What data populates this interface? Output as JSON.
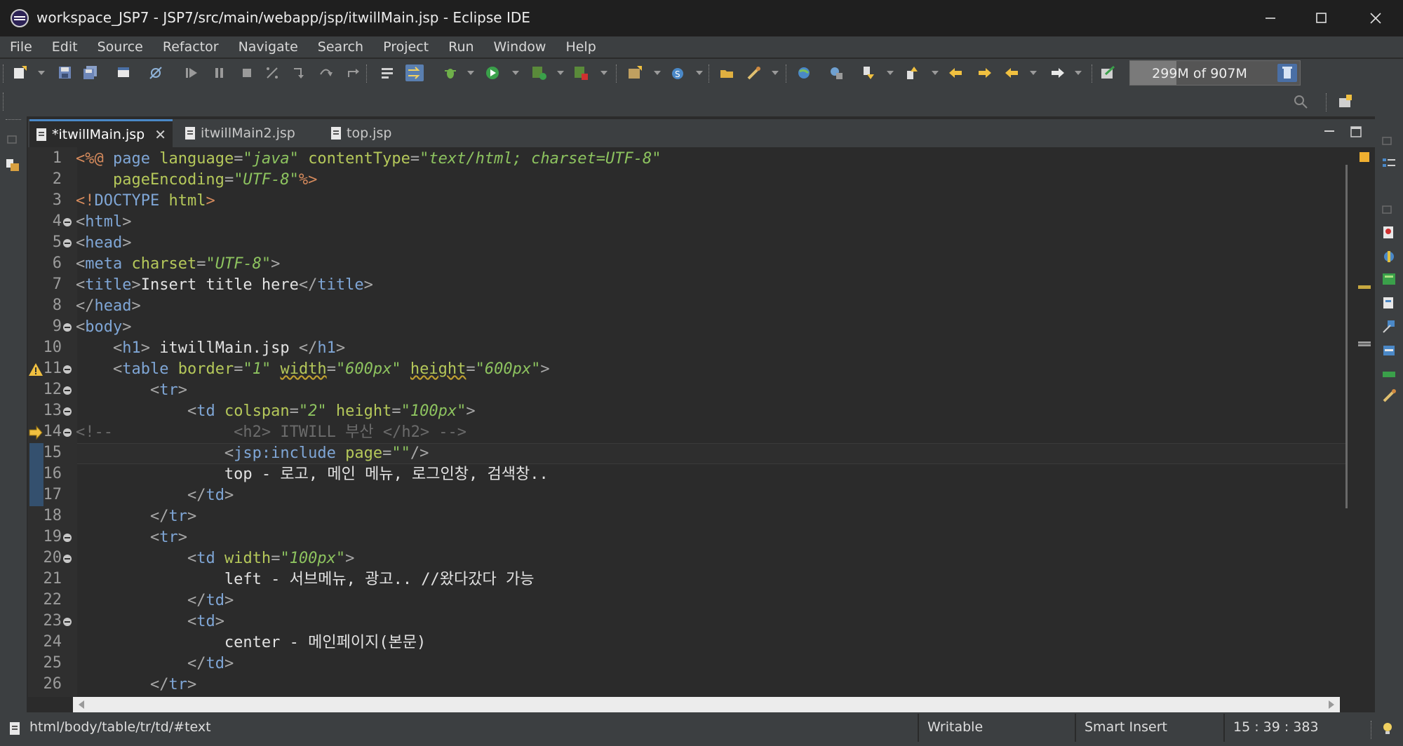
{
  "window": {
    "title": "workspace_JSP7 - JSP7/src/main/webapp/jsp/itwillMain.jsp - Eclipse IDE",
    "controls": [
      "minimize-icon",
      "maximize-icon",
      "close-icon"
    ]
  },
  "menubar": {
    "items": [
      "File",
      "Edit",
      "Source",
      "Refactor",
      "Navigate",
      "Search",
      "Project",
      "Run",
      "Window",
      "Help"
    ]
  },
  "toolbar": {
    "heap_status": "299M of 907M",
    "heap_used_fraction": 0.33,
    "icons": [
      "new-icon",
      "save-icon",
      "save-all-icon",
      "console-icon",
      "skip-breakpoints-icon",
      "resume-icon",
      "suspend-icon",
      "terminate-icon",
      "disconnect-icon",
      "step-into-icon",
      "step-over-icon",
      "step-return-icon",
      "drop-to-frame-icon",
      "use-step-filters-icon",
      "debug-icon",
      "run-icon",
      "run-server-icon",
      "stop-server-icon",
      "new-package-icon",
      "new-class-icon",
      "open-type-icon",
      "search-icon",
      "web-browser-icon",
      "external-tools-icon",
      "next-annotation-icon",
      "previous-annotation-icon",
      "back-icon",
      "forward-icon",
      "last-edit-icon",
      "pin-editor-icon",
      "garbage-collect-icon",
      "quick-access-search-icon",
      "open-perspective-icon",
      "java-ee-perspective-icon"
    ]
  },
  "tabs": [
    {
      "label": "*itwillMain.jsp",
      "active": true,
      "closable": true
    },
    {
      "label": "itwillMain2.jsp",
      "active": false,
      "closable": false
    },
    {
      "label": "top.jsp",
      "active": false,
      "closable": false
    }
  ],
  "editor": {
    "line_numbers": [
      "1",
      "2",
      "3",
      "4",
      "5",
      "6",
      "7",
      "8",
      "9",
      "10",
      "11",
      "12",
      "13",
      "14",
      "15",
      "16",
      "17",
      "18",
      "19",
      "20",
      "21",
      "22",
      "23",
      "24",
      "25",
      "26"
    ],
    "current_line": "15",
    "lines": [
      [
        [
          "d",
          "<%@"
        ],
        [
          "w",
          " "
        ],
        [
          "t",
          "page"
        ],
        [
          "w",
          " "
        ],
        [
          "a",
          "language"
        ],
        [
          "p",
          "="
        ],
        [
          "v",
          "\"java\""
        ],
        [
          "w",
          " "
        ],
        [
          "a",
          "contentType"
        ],
        [
          "p",
          "="
        ],
        [
          "v",
          "\"text/html; charset=UTF-8\""
        ]
      ],
      [
        [
          "w",
          "    "
        ],
        [
          "a",
          "pageEncoding"
        ],
        [
          "p",
          "="
        ],
        [
          "v",
          "\"UTF-8\""
        ],
        [
          "d",
          "%>"
        ]
      ],
      [
        [
          "d",
          "<!"
        ],
        [
          "t",
          "DOCTYPE"
        ],
        [
          "w",
          " "
        ],
        [
          "a",
          "html"
        ],
        [
          "d",
          ">"
        ]
      ],
      [
        [
          "p",
          "<"
        ],
        [
          "t",
          "html"
        ],
        [
          "p",
          ">"
        ]
      ],
      [
        [
          "p",
          "<"
        ],
        [
          "t",
          "head"
        ],
        [
          "p",
          ">"
        ]
      ],
      [
        [
          "p",
          "<"
        ],
        [
          "t",
          "meta"
        ],
        [
          "w",
          " "
        ],
        [
          "a",
          "charset"
        ],
        [
          "p",
          "="
        ],
        [
          "v",
          "\"UTF-8\""
        ],
        [
          "p",
          ">"
        ]
      ],
      [
        [
          "p",
          "<"
        ],
        [
          "t",
          "title"
        ],
        [
          "p",
          ">"
        ],
        [
          "w",
          "Insert title here"
        ],
        [
          "p",
          "</"
        ],
        [
          "t",
          "title"
        ],
        [
          "p",
          ">"
        ]
      ],
      [
        [
          "p",
          "</"
        ],
        [
          "t",
          "head"
        ],
        [
          "p",
          ">"
        ]
      ],
      [
        [
          "p",
          "<"
        ],
        [
          "t",
          "body"
        ],
        [
          "p",
          ">"
        ]
      ],
      [
        [
          "w",
          "    "
        ],
        [
          "p",
          "<"
        ],
        [
          "t",
          "h1"
        ],
        [
          "p",
          ">"
        ],
        [
          "w",
          " itwillMain.jsp "
        ],
        [
          "p",
          "</"
        ],
        [
          "t",
          "h1"
        ],
        [
          "p",
          ">"
        ]
      ],
      [
        [
          "w",
          "    "
        ],
        [
          "p",
          "<"
        ],
        [
          "t",
          "table"
        ],
        [
          "w",
          " "
        ],
        [
          "a",
          "border"
        ],
        [
          "p",
          "="
        ],
        [
          "v",
          "\"1\""
        ],
        [
          "w",
          " "
        ],
        [
          "a",
          "width"
        ],
        [
          "p",
          "="
        ],
        [
          "v",
          "\"600px\""
        ],
        [
          "w",
          " "
        ],
        [
          "a",
          "height"
        ],
        [
          "p",
          "="
        ],
        [
          "v",
          "\"600px\""
        ],
        [
          "p",
          ">"
        ]
      ],
      [
        [
          "w",
          "        "
        ],
        [
          "p",
          "<"
        ],
        [
          "t",
          "tr"
        ],
        [
          "p",
          ">"
        ]
      ],
      [
        [
          "w",
          "            "
        ],
        [
          "p",
          "<"
        ],
        [
          "t",
          "td"
        ],
        [
          "w",
          " "
        ],
        [
          "a",
          "colspan"
        ],
        [
          "p",
          "="
        ],
        [
          "v",
          "\"2\""
        ],
        [
          "w",
          " "
        ],
        [
          "a",
          "height"
        ],
        [
          "p",
          "="
        ],
        [
          "v",
          "\"100px\""
        ],
        [
          "p",
          ">"
        ]
      ],
      [
        [
          "c",
          "<!--             <h2> ITWILL 부산 </h2> -->"
        ]
      ],
      [
        [
          "w",
          "                "
        ],
        [
          "p",
          "<"
        ],
        [
          "t",
          "jsp:include"
        ],
        [
          "w",
          " "
        ],
        [
          "a",
          "page"
        ],
        [
          "p",
          "="
        ],
        [
          "v",
          "\"\""
        ],
        [
          "p",
          "/>"
        ]
      ],
      [
        [
          "w",
          "                top - 로고, 메인 메뉴, 로그인창, 검색창.."
        ]
      ],
      [
        [
          "w",
          "            "
        ],
        [
          "p",
          "</"
        ],
        [
          "t",
          "td"
        ],
        [
          "p",
          ">"
        ]
      ],
      [
        [
          "w",
          "        "
        ],
        [
          "p",
          "</"
        ],
        [
          "t",
          "tr"
        ],
        [
          "p",
          ">"
        ]
      ],
      [
        [
          "w",
          "        "
        ],
        [
          "p",
          "<"
        ],
        [
          "t",
          "tr"
        ],
        [
          "p",
          ">"
        ]
      ],
      [
        [
          "w",
          "            "
        ],
        [
          "p",
          "<"
        ],
        [
          "t",
          "td"
        ],
        [
          "w",
          " "
        ],
        [
          "a",
          "width"
        ],
        [
          "p",
          "="
        ],
        [
          "v",
          "\"100px\""
        ],
        [
          "p",
          ">"
        ]
      ],
      [
        [
          "w",
          "                left - 서브메뉴, 광고.. //왔다갔다 가능"
        ]
      ],
      [
        [
          "w",
          "            "
        ],
        [
          "p",
          "</"
        ],
        [
          "t",
          "td"
        ],
        [
          "p",
          ">"
        ]
      ],
      [
        [
          "w",
          "            "
        ],
        [
          "p",
          "<"
        ],
        [
          "t",
          "td"
        ],
        [
          "p",
          ">"
        ]
      ],
      [
        [
          "w",
          "                center - 메인페이지(본문)"
        ]
      ],
      [
        [
          "w",
          "            "
        ],
        [
          "p",
          "</"
        ],
        [
          "t",
          "td"
        ],
        [
          "p",
          ">"
        ]
      ],
      [
        [
          "w",
          "        "
        ],
        [
          "p",
          "</"
        ],
        [
          "t",
          "tr"
        ],
        [
          "p",
          ">"
        ]
      ]
    ],
    "fold_lines": [
      "4",
      "5",
      "9",
      "11",
      "12",
      "13",
      "14",
      "19",
      "20",
      "23"
    ],
    "warning_line": "11",
    "bookmark_line": "14",
    "changed_lines": [
      "15",
      "16",
      "17"
    ]
  },
  "statusbar": {
    "breadcrumb": "html/body/table/tr/td/#text",
    "writable": "Writable",
    "insert_mode": "Smart Insert",
    "position": "15 : 39 : 383"
  },
  "colors": {
    "background": "#2b2b2b",
    "chrome": "#3c3f41",
    "tag": "#7fa6d6",
    "attribute": "#b5c85a",
    "value": "#8dc35f",
    "directive": "#d58a5c"
  }
}
